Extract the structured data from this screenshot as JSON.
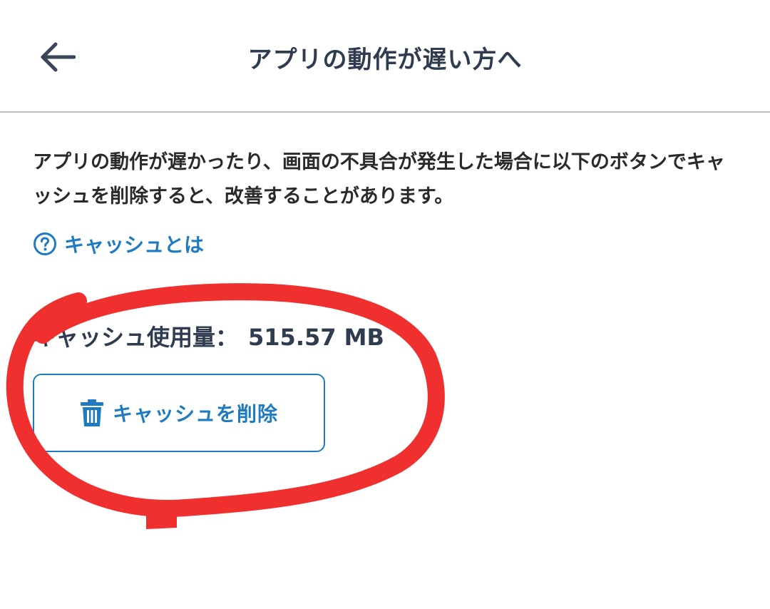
{
  "header": {
    "title": "アプリの動作が遅い方へ",
    "back_icon": "arrow-left-icon"
  },
  "content": {
    "description": "アプリの動作が遅かったり、画面の不具合が発生した場合に以下のボタンでキャッシュを削除すると、改善することがあります。",
    "help_link": {
      "icon": "question-circle-icon",
      "label": "キャッシュとは"
    },
    "cache_usage": {
      "label": "キャッシュ使用量：",
      "value": "515.57 MB"
    },
    "delete_button": {
      "icon": "trash-icon",
      "label": "キャッシュを削除"
    }
  },
  "colors": {
    "accent": "#1f7bc1",
    "title_text": "#2f3c4f",
    "body_text": "#2a2a2a",
    "divider": "#b9bcc0",
    "annotation_red": "#f0302e"
  }
}
